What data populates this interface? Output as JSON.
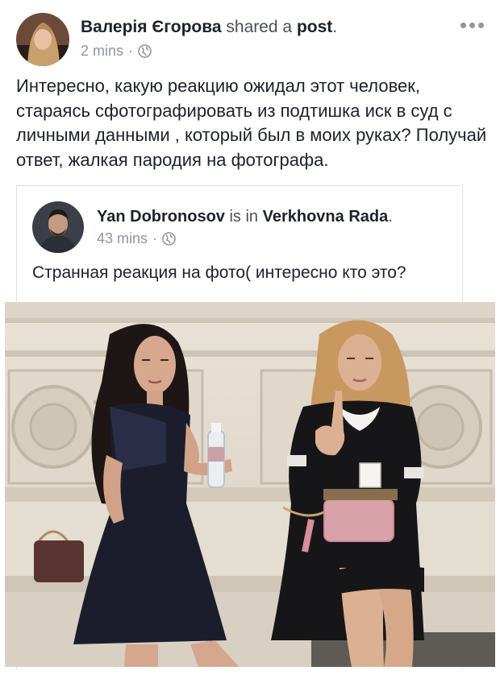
{
  "post": {
    "author": "Валерія Єгорова",
    "action": "shared a",
    "object": "post",
    "object_suffix": ".",
    "time": "2 mins",
    "separator": "·",
    "privacy_icon": "globe-icon",
    "more_icon": "ellipsis-icon",
    "text": "Интересно, какую реакцию ожидал этот человек, стараясь сфотографировать из подтишка иск в суд с личными данными , который был в моих руках? Получай ответ, жалкая пародия на фотографа."
  },
  "shared_post": {
    "author": "Yan Dobronosov",
    "connector": "is in",
    "location": "Verkhovna Rada",
    "location_suffix": ".",
    "time": "43 mins",
    "separator": "·",
    "privacy_icon": "globe-icon",
    "text": "Странная реакция на фото( интересно кто это?"
  },
  "colors": {
    "text": "#1d2129",
    "meta": "#90949c",
    "border": "#dddfe2"
  }
}
